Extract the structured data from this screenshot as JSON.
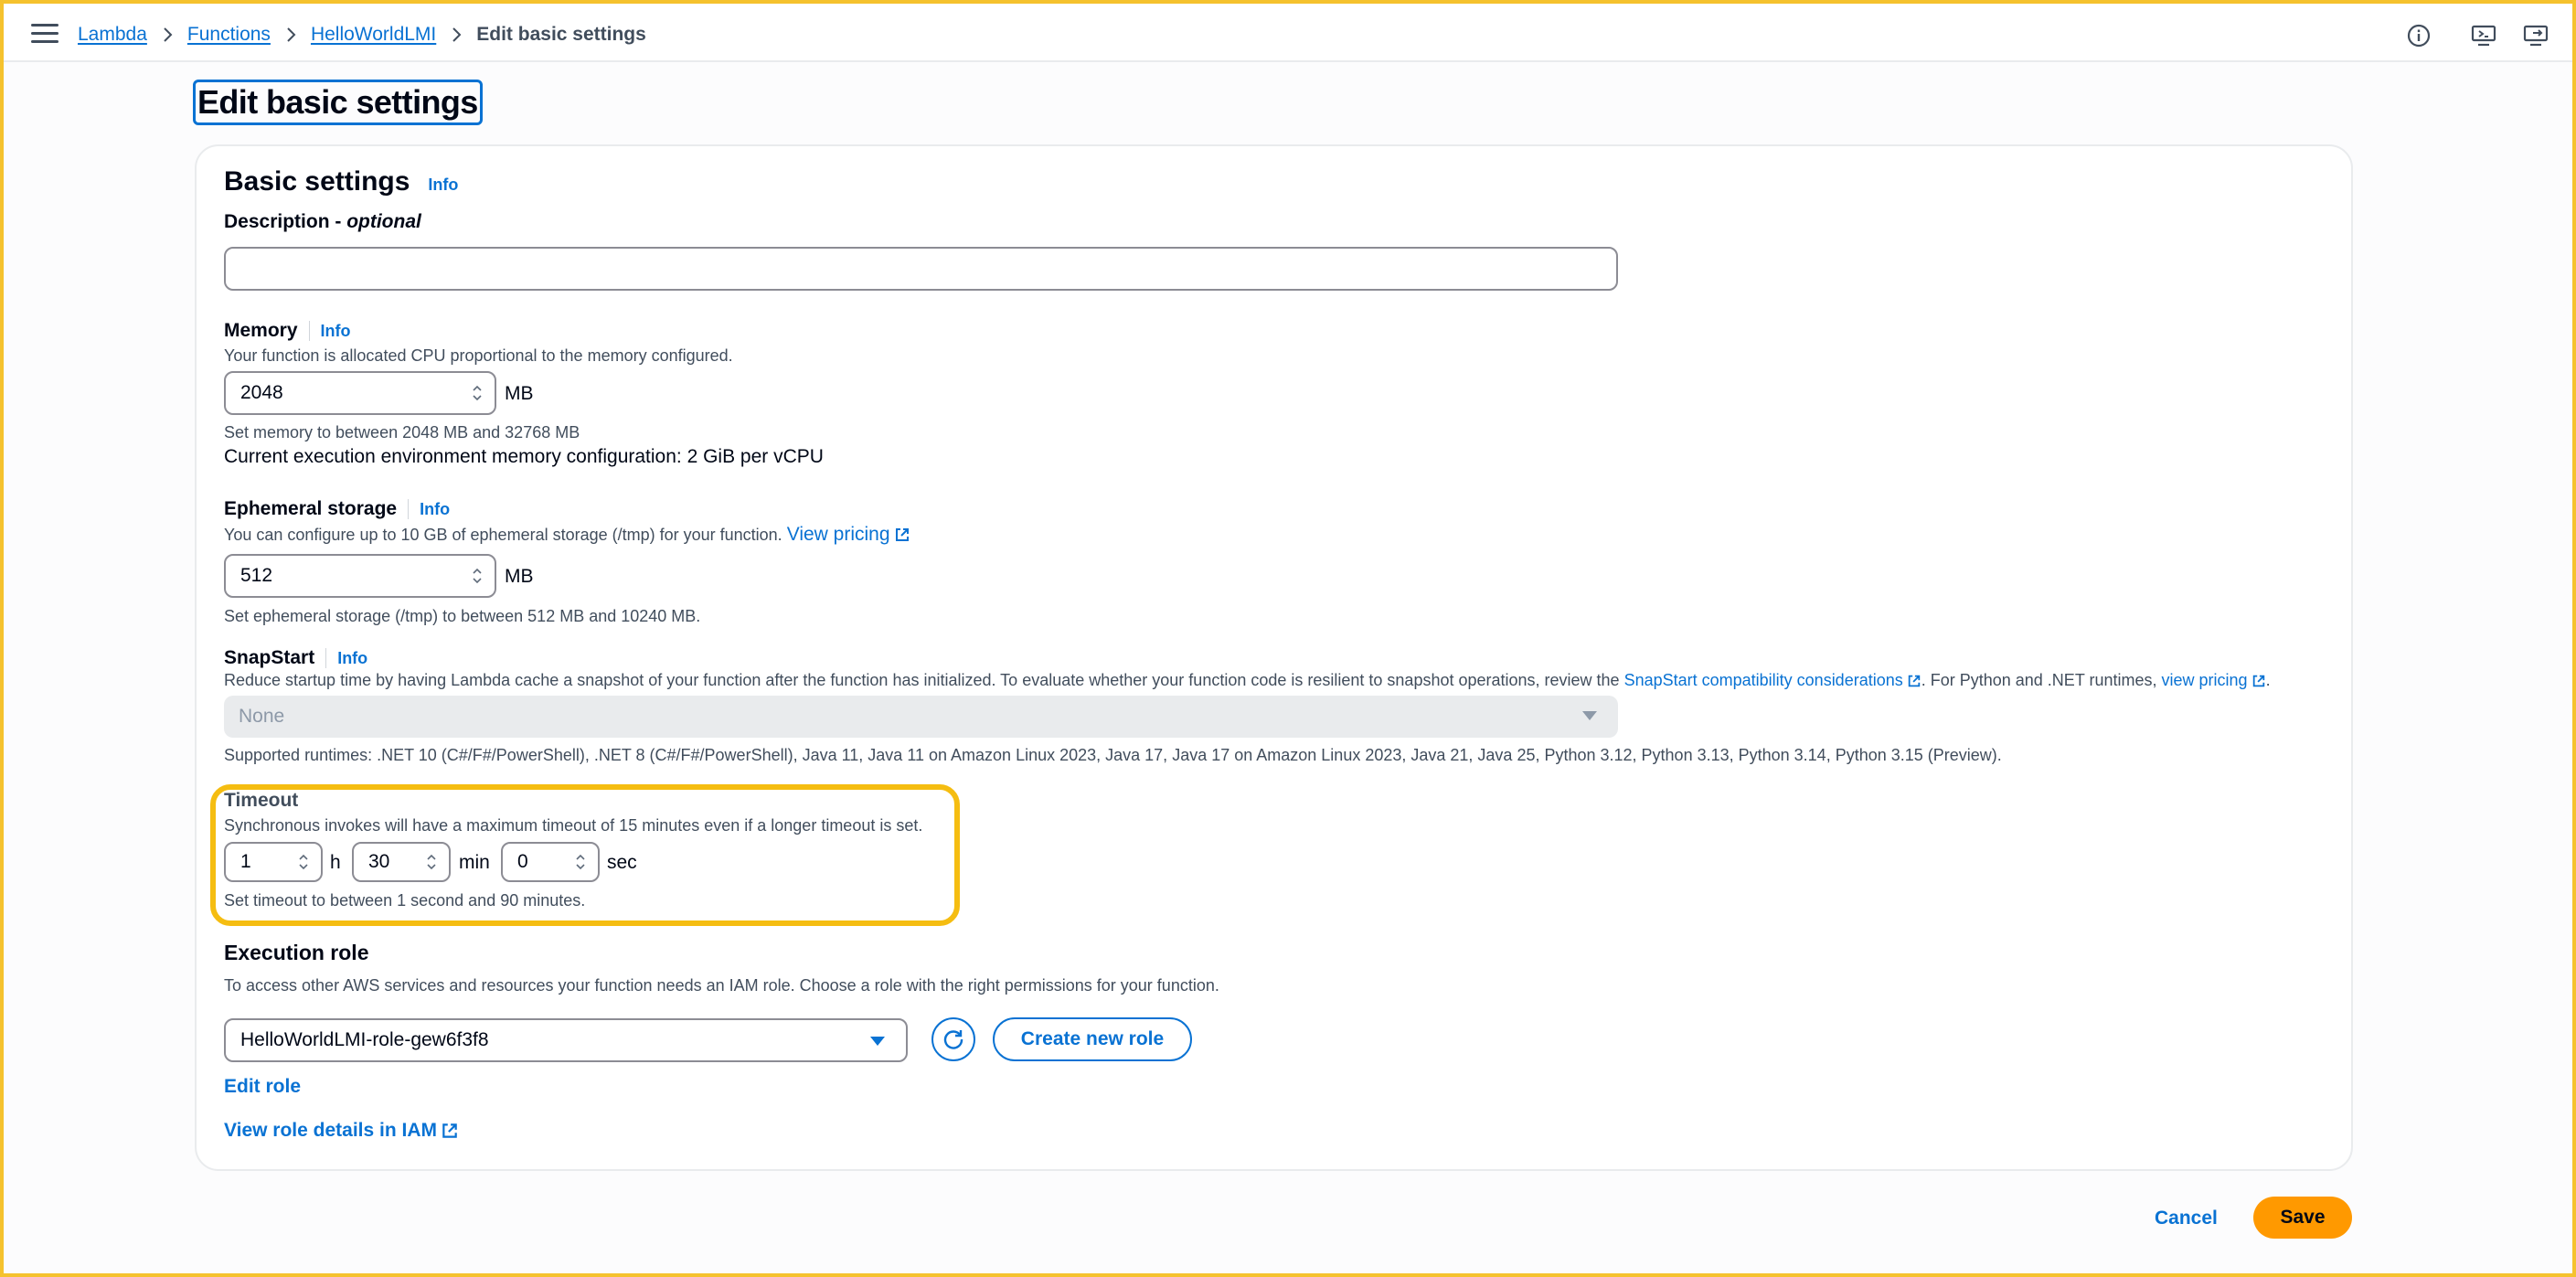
{
  "breadcrumb": {
    "items": [
      "Lambda",
      "Functions",
      "HelloWorldLMI"
    ],
    "current": "Edit basic settings"
  },
  "page_title": "Edit basic settings",
  "panel": {
    "title": "Basic settings",
    "info_label": "Info",
    "description": {
      "label": "Description",
      "label_suffix": " - ",
      "label_optional": "optional",
      "value": "",
      "placeholder": ""
    },
    "memory": {
      "label": "Memory",
      "info_label": "Info",
      "description": "Your function is allocated CPU proportional to the memory configured.",
      "value": "2048",
      "unit": "MB",
      "hint": "Set memory to between 2048 MB and 32768 MB",
      "config_text": "Current execution environment memory configuration: 2 GiB per vCPU"
    },
    "ephemeral": {
      "label": "Ephemeral storage",
      "info_label": "Info",
      "description": "You can configure up to 10 GB of ephemeral storage (/tmp) for your function.",
      "pricing_link": "View pricing",
      "value": "512",
      "unit": "MB",
      "hint": "Set ephemeral storage (/tmp) to between 512 MB and 10240 MB."
    },
    "snapstart": {
      "label": "SnapStart",
      "info_label": "Info",
      "description_part1": "Reduce startup time by having Lambda cache a snapshot of your function after the function has initialized. To evaluate whether your function code is resilient to snapshot operations, review the ",
      "compat_link": "SnapStart compatibility considerations",
      "description_part2": ". For Python and .NET runtimes, ",
      "pricing_link": "view pricing",
      "description_part3": ".",
      "selected": "None",
      "supported": "Supported runtimes: .NET 10 (C#/F#/PowerShell), .NET 8 (C#/F#/PowerShell), Java 11, Java 11 on Amazon Linux 2023, Java 17, Java 17 on Amazon Linux 2023, Java 21, Java 25, Python 3.12, Python 3.13, Python 3.14, Python 3.15 (Preview)."
    },
    "timeout": {
      "label": "Timeout",
      "description": "Synchronous invokes will have a maximum timeout of 15 minutes even if a longer timeout is set.",
      "hours": "1",
      "hours_unit": "h",
      "minutes": "30",
      "minutes_unit": "min",
      "seconds": "0",
      "seconds_unit": "sec",
      "hint": "Set timeout to between 1 second and 90 minutes."
    },
    "execution_role": {
      "label": "Execution role",
      "description": "To access other AWS services and resources your function needs an IAM role. Choose a role with the right permissions for your function.",
      "selected": "HelloWorldLMI-role-gew6f3f8",
      "create_label": "Create new role",
      "edit_label": "Edit role",
      "view_label": "View role details in IAM"
    }
  },
  "actions": {
    "cancel_label": "Cancel",
    "save_label": "Save"
  },
  "colors": {
    "link": "#0972d3",
    "primary_button": "#ff9900",
    "highlight": "#f5bd11"
  }
}
